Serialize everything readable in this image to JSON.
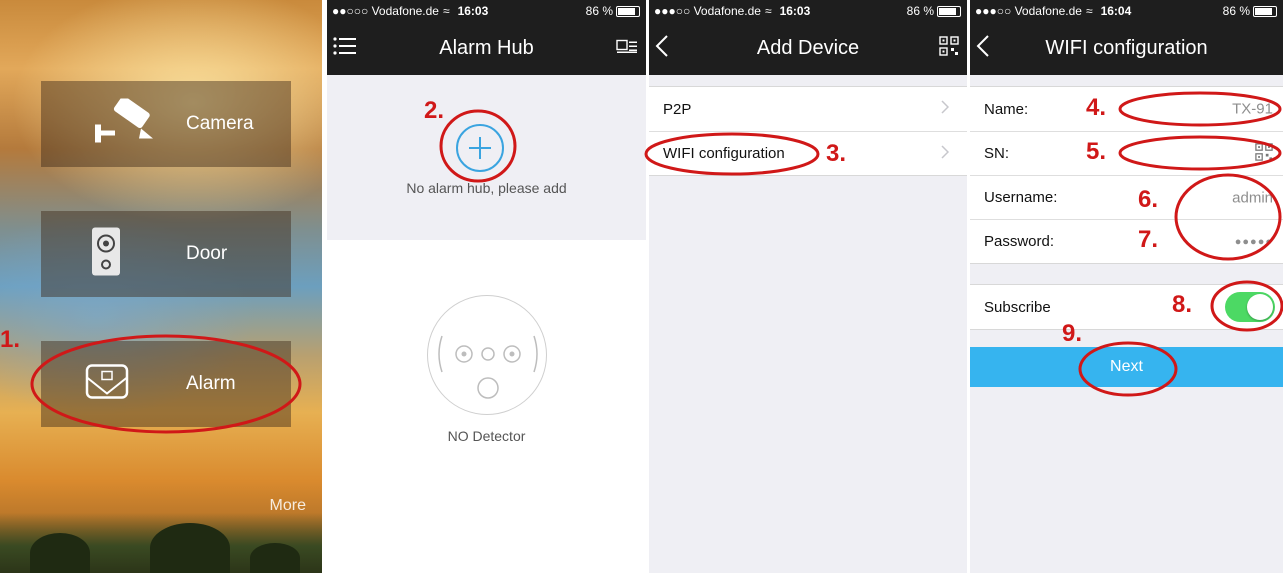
{
  "screens": {
    "home": {
      "tiles": [
        {
          "label": "Camera",
          "icon": "camera-icon"
        },
        {
          "label": "Door",
          "icon": "doorbell-icon"
        },
        {
          "label": "Alarm",
          "icon": "alarm-icon"
        }
      ],
      "more_label": "More"
    },
    "alarm_hub": {
      "status": {
        "carrier": "●●○○○ Vodafone.de",
        "time": "16:03",
        "battery": "86 %"
      },
      "title": "Alarm Hub",
      "empty_hub_text": "No alarm hub, please add",
      "no_detector_text": "NO Detector"
    },
    "add_device": {
      "status": {
        "carrier": "●●●○○ Vodafone.de",
        "time": "16:03",
        "battery": "86 %"
      },
      "title": "Add Device",
      "items": [
        "P2P",
        "WIFI configuration"
      ]
    },
    "wifi_config": {
      "status": {
        "carrier": "●●●○○ Vodafone.de",
        "time": "16:04",
        "battery": "86 %"
      },
      "title": "WIFI configuration",
      "fields": [
        {
          "label": "Name:",
          "value": "TX-91"
        },
        {
          "label": "SN:",
          "value": ""
        },
        {
          "label": "Username:",
          "value": "admin"
        },
        {
          "label": "Password:",
          "value": "●●●●●"
        }
      ],
      "subscribe_label": "Subscribe",
      "subscribe_on": true,
      "next_label": "Next"
    }
  },
  "annotations": [
    "1.",
    "2.",
    "3.",
    "4.",
    "5.",
    "6.",
    "7.",
    "8.",
    "9."
  ],
  "colors": {
    "accent": "#36b4ef",
    "annotation": "#d01818",
    "toggle_on": "#4cd964",
    "bar": "#1e1e1e"
  }
}
